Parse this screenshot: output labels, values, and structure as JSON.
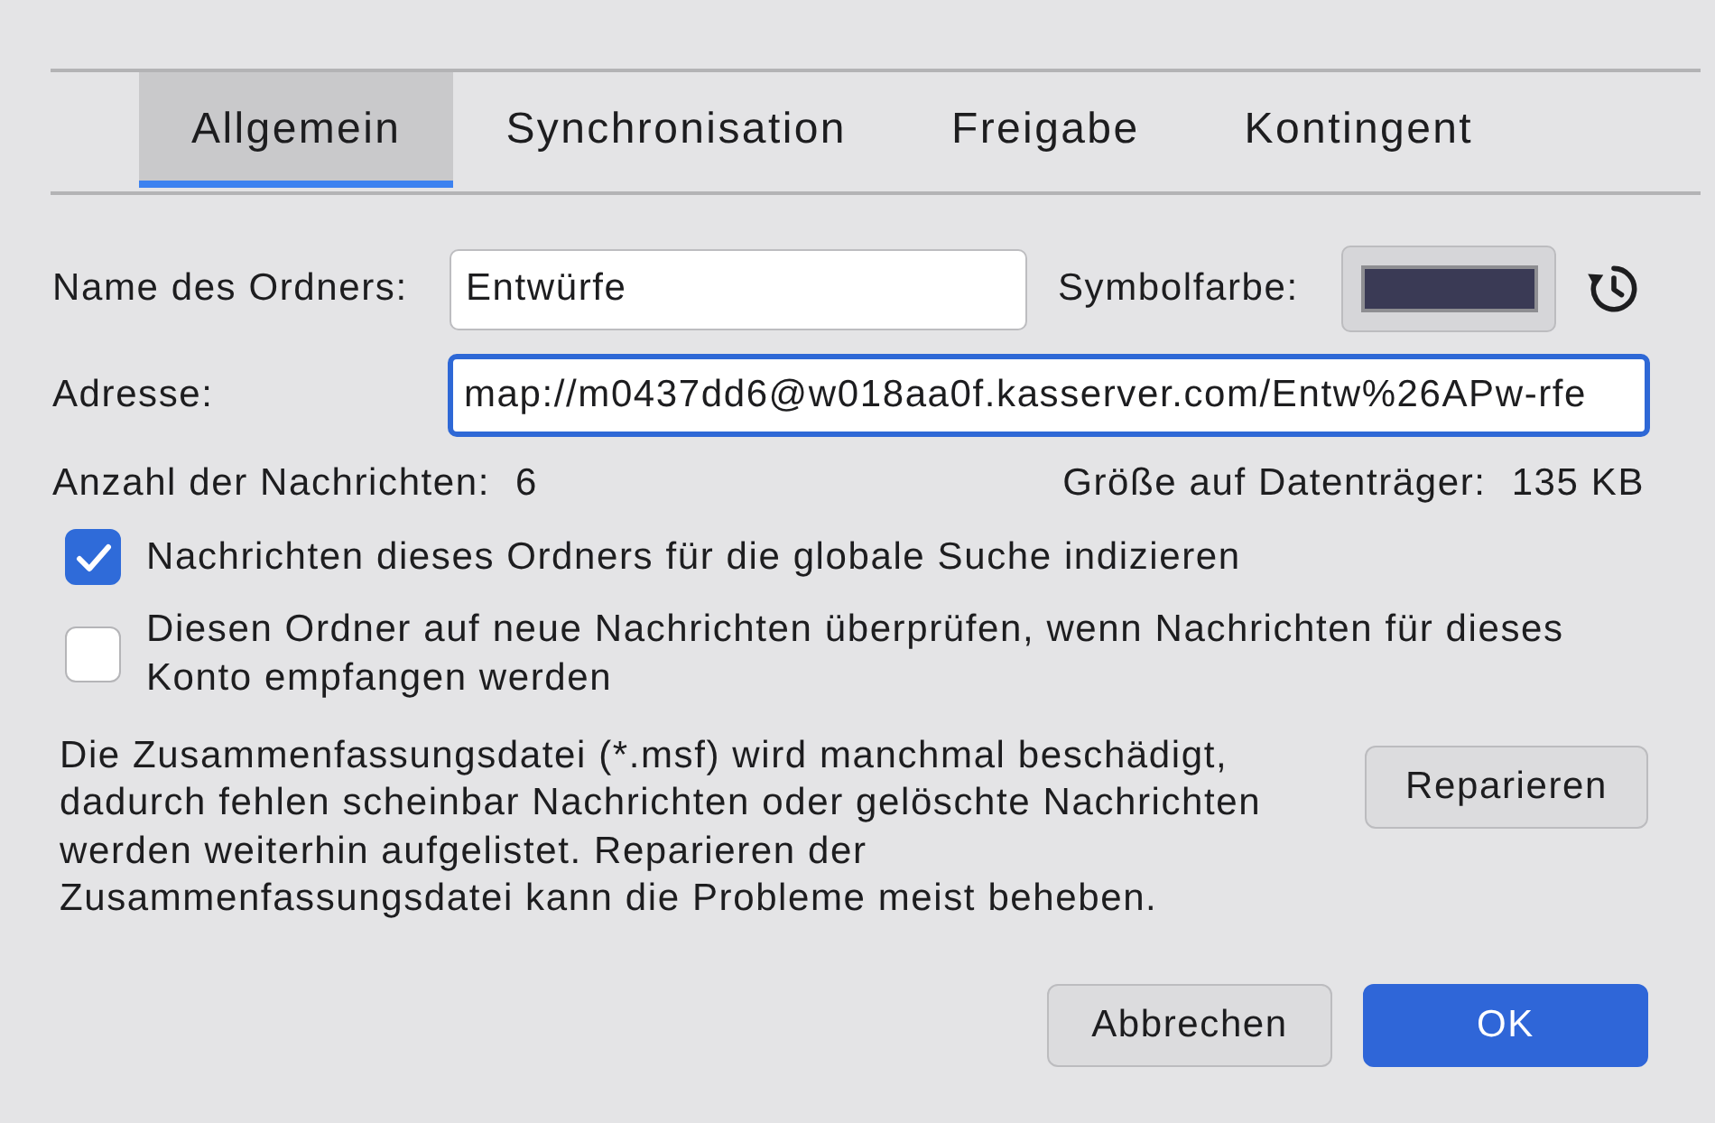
{
  "tabs": [
    {
      "label": "Allgemein",
      "selected": true
    },
    {
      "label": "Synchronisation",
      "selected": false
    },
    {
      "label": "Freigabe",
      "selected": false
    },
    {
      "label": "Kontingent",
      "selected": false
    }
  ],
  "folder_name": {
    "label": "Name des Ordners:",
    "value": "Entwürfe"
  },
  "icon_color": {
    "label": "Symbolfarbe:",
    "color": "#3a3a55"
  },
  "address": {
    "label": "Adresse:",
    "value": "map://m0437dd6@w018aa0f.kasserver.com/Entw%26APw-rfe",
    "focused": true
  },
  "message_count": {
    "label": "Anzahl der Nachrichten:",
    "value": "6"
  },
  "disk_size": {
    "label": "Größe auf Datenträger:",
    "value": "135 KB"
  },
  "options": [
    {
      "label": "Nachrichten dieses Ordners für die globale Suche indizieren",
      "checked": true
    },
    {
      "label": "Diesen Ordner auf neue Nachrichten überprüfen, wenn Nachrichten für dieses Konto empfangen werden",
      "checked": false
    }
  ],
  "repair": {
    "text": "Die Zusammenfassungsdatei (*.msf) wird manchmal beschädigt,\ndadurch fehlen scheinbar Nachrichten oder gelöschte Nachrichten\nwerden weiterhin aufgelistet. Reparieren der\nZusammenfassungsdatei kann die Probleme meist beheben.",
    "button": "Reparieren"
  },
  "buttons": [
    {
      "label": "Abbrechen",
      "kind": "secondary"
    },
    {
      "label": "OK",
      "kind": "primary"
    }
  ]
}
